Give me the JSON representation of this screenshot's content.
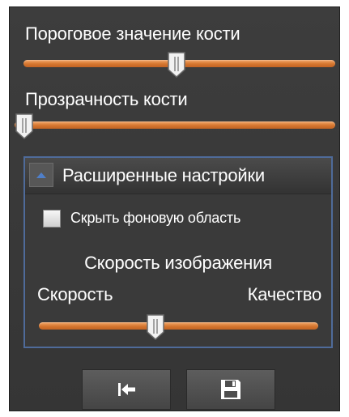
{
  "bone_threshold": {
    "label": "Пороговое значение кости",
    "value_percent": 49
  },
  "bone_transparency": {
    "label": "Прозрачность кости",
    "value_percent": 0
  },
  "advanced": {
    "title": "Расширенные настройки",
    "hide_background": {
      "label": "Скрыть фоновую область",
      "checked": false
    },
    "render_speed": {
      "title": "Скорость изображения",
      "min_label": "Скорость",
      "max_label": "Качество",
      "value_percent": 41
    }
  },
  "toolbar": {
    "reset_icon": "arrow-to-start-icon",
    "save_icon": "floppy-disk-icon"
  },
  "colors": {
    "panel": "#3d3d3d",
    "slider_track": "#d6762f",
    "group_border": "#4f6b9a",
    "text": "#ffffff"
  }
}
